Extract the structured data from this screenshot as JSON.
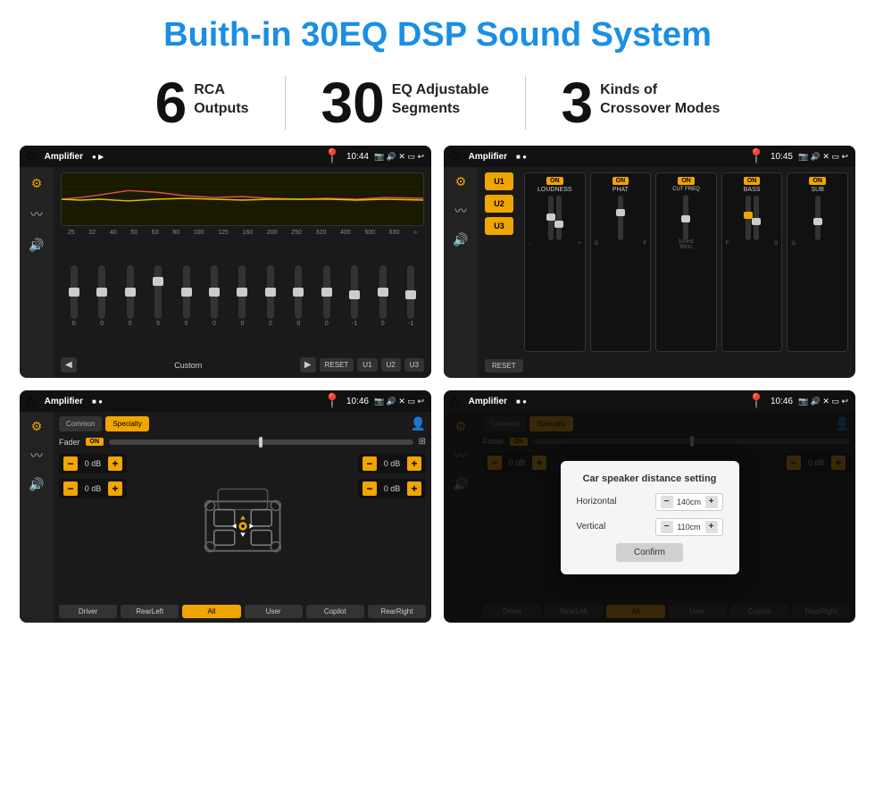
{
  "page": {
    "title": "Buith-in 30EQ DSP Sound System",
    "stats": [
      {
        "number": "6",
        "line1": "RCA",
        "line2": "Outputs"
      },
      {
        "number": "30",
        "line1": "EQ Adjustable",
        "line2": "Segments"
      },
      {
        "number": "3",
        "line1": "Kinds of",
        "line2": "Crossover Modes"
      }
    ]
  },
  "screens": {
    "screen1": {
      "statusBar": {
        "appName": "Amplifier",
        "time": "10:44"
      },
      "freqLabels": [
        "25",
        "32",
        "40",
        "50",
        "63",
        "80",
        "100",
        "125",
        "160",
        "200",
        "250",
        "320",
        "400",
        "500",
        "630"
      ],
      "sliderValues": [
        "0",
        "0",
        "0",
        "5",
        "0",
        "0",
        "0",
        "0",
        "0",
        "0",
        "-1",
        "0",
        "-1"
      ],
      "controls": [
        "Custom",
        "RESET",
        "U1",
        "U2",
        "U3"
      ]
    },
    "screen2": {
      "statusBar": {
        "appName": "Amplifier",
        "time": "10:45"
      },
      "presets": [
        "U1",
        "U2",
        "U3"
      ],
      "modules": [
        "LOUDNESS",
        "PHAT",
        "CUT FREQ",
        "BASS",
        "SUB"
      ],
      "resetLabel": "RESET"
    },
    "screen3": {
      "statusBar": {
        "appName": "Amplifier",
        "time": "10:46"
      },
      "tabs": [
        "Common",
        "Specialty"
      ],
      "faderLabel": "Fader",
      "dBValues": [
        "0 dB",
        "0 dB",
        "0 dB",
        "0 dB"
      ],
      "buttons": [
        "Driver",
        "RearLeft",
        "All",
        "User",
        "Copilot",
        "RearRight"
      ]
    },
    "screen4": {
      "statusBar": {
        "appName": "Amplifier",
        "time": "10:46"
      },
      "tabs": [
        "Common",
        "Specialty"
      ],
      "dialog": {
        "title": "Car speaker distance setting",
        "horizontal": {
          "label": "Horizontal",
          "value": "140cm"
        },
        "vertical": {
          "label": "Vertical",
          "value": "110cm"
        },
        "confirmLabel": "Confirm"
      },
      "dBValues": [
        "0 dB",
        "0 dB"
      ],
      "buttons": [
        "Driver",
        "RearLeft",
        "All",
        "User",
        "Copilot",
        "RearRight"
      ]
    }
  }
}
